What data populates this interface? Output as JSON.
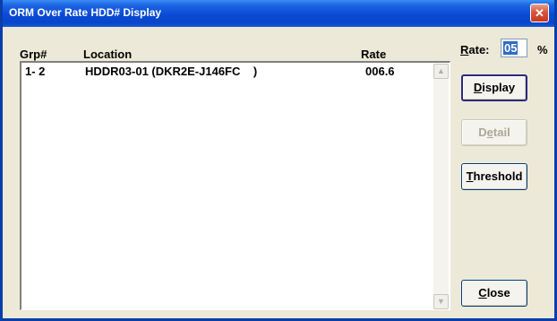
{
  "window": {
    "title": "ORM Over Rate HDD# Display",
    "close_glyph": "✕"
  },
  "list": {
    "headers": {
      "grp": "Grp#",
      "location": "Location",
      "rate": "Rate"
    },
    "rows": [
      {
        "grp": "1- 2",
        "location": "HDDR03-01 (DKR2E-J146FC    )",
        "rate": "006.6"
      }
    ]
  },
  "rate_field": {
    "label_first": "R",
    "label_rest": "ate:",
    "value": "05",
    "unit": "%"
  },
  "buttons": {
    "display": {
      "mnemonic": "D",
      "rest": "isplay"
    },
    "detail": {
      "before": "D",
      "mnemonic": "e",
      "rest": "tail"
    },
    "threshold": {
      "mnemonic": "T",
      "rest": "hreshold"
    },
    "close": {
      "mnemonic": "C",
      "rest": "lose"
    }
  },
  "icons": [
    "close-icon",
    "scroll-up-arrow-icon",
    "scroll-down-arrow-icon"
  ]
}
